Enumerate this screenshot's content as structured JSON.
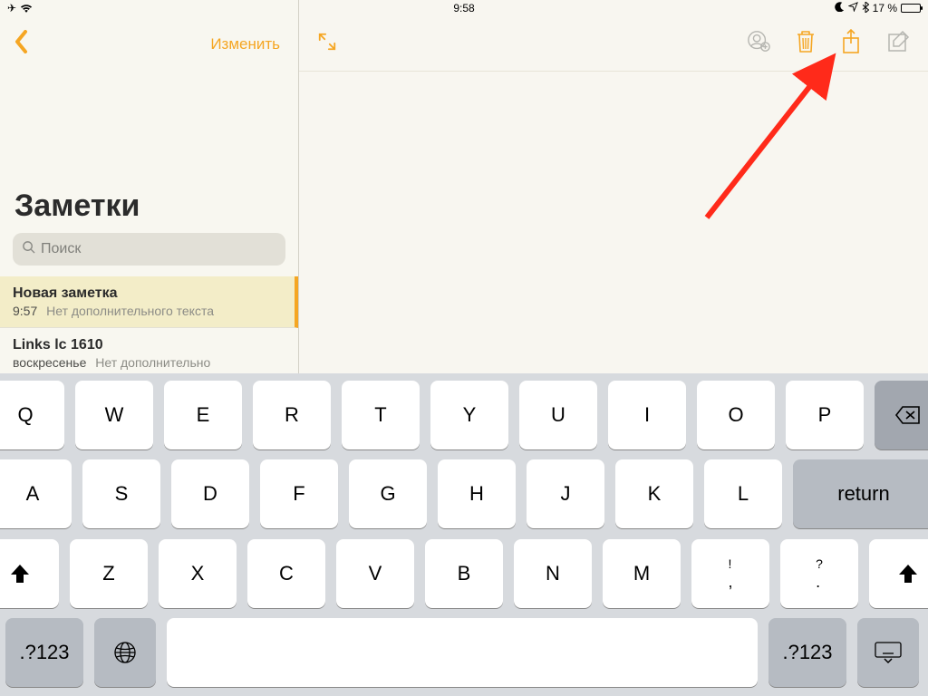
{
  "statusbar": {
    "time": "9:58",
    "battery_label": "17 %"
  },
  "sidebar": {
    "edit_label": "Изменить",
    "title": "Заметки",
    "search_placeholder": "Поиск",
    "notes": [
      {
        "title": "Новая заметка",
        "time": "9:57",
        "snippet": "Нет дополнительного текста"
      },
      {
        "title": "Links lc 1610",
        "time": "воскресенье",
        "snippet": "Нет дополнительно"
      }
    ]
  },
  "keyboard": {
    "row1": [
      "Q",
      "W",
      "E",
      "R",
      "T",
      "Y",
      "U",
      "I",
      "O",
      "P"
    ],
    "row2": [
      "A",
      "S",
      "D",
      "F",
      "G",
      "H",
      "J",
      "K",
      "L"
    ],
    "row3": [
      "Z",
      "X",
      "C",
      "V",
      "B",
      "N",
      "M"
    ],
    "punc1_top": "!",
    "punc1_bot": ",",
    "punc2_top": "?",
    "punc2_bot": ".",
    "return_label": "return",
    "modes_label": ".?123"
  }
}
